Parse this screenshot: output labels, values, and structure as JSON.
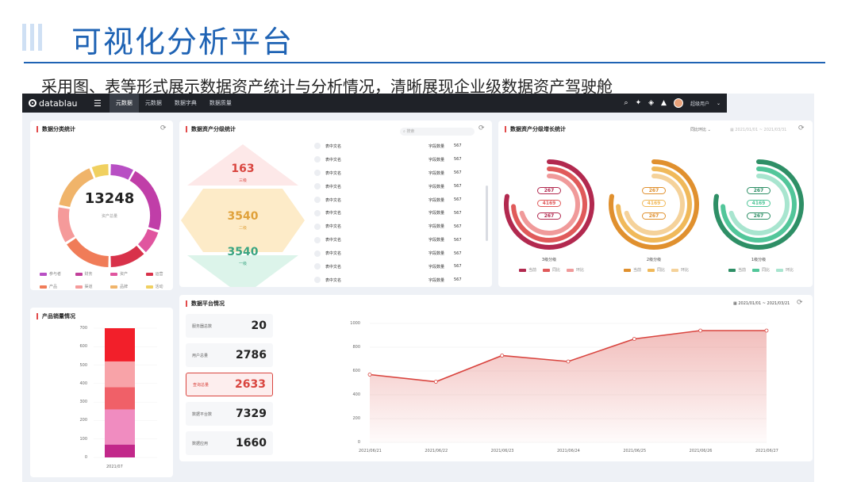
{
  "slide": {
    "title": "可视化分析平台",
    "subtitle": "采用图、表等形式展示数据资产统计与分析情况，清晰展现企业级数据资产驾驶舱"
  },
  "topbar": {
    "logo": "datablau",
    "nav": [
      "元数据",
      "元数据",
      "数据字典",
      "数据质量"
    ],
    "active_index": 0,
    "user": "超级用户"
  },
  "category_stats": {
    "title": "数据分类统计",
    "total": "13248",
    "total_label": "资产总量",
    "legend": [
      {
        "label": "参与者",
        "color": "#b84fc4"
      },
      {
        "label": "财务",
        "color": "#c2409a"
      },
      {
        "label": "资产",
        "color": "#e0559f"
      },
      {
        "label": "运营",
        "color": "#d8324a"
      },
      {
        "label": "产品",
        "color": "#f07c58"
      },
      {
        "label": "渠道",
        "color": "#f59a9a"
      },
      {
        "label": "品牌",
        "color": "#f0b46a"
      },
      {
        "label": "活动",
        "color": "#f0d060"
      }
    ]
  },
  "level_stats": {
    "title": "数据资产分级统计",
    "search_placeholder": "搜索",
    "levels": [
      {
        "value": "163",
        "label": "三级",
        "color": "#d9453f"
      },
      {
        "value": "3540",
        "label": "二级",
        "color": "#e0a13a"
      },
      {
        "value": "3540",
        "label": "一级",
        "color": "#3aa582"
      }
    ],
    "rows": [
      {
        "name": "表中文名",
        "field": "字段数量",
        "count": "567"
      },
      {
        "name": "表中文名",
        "field": "字段数量",
        "count": "567"
      },
      {
        "name": "表中文名",
        "field": "字段数量",
        "count": "567"
      },
      {
        "name": "表中文名",
        "field": "字段数量",
        "count": "567"
      },
      {
        "name": "表中文名",
        "field": "字段数量",
        "count": "567"
      },
      {
        "name": "表中文名",
        "field": "字段数量",
        "count": "567"
      },
      {
        "name": "表中文名",
        "field": "字段数量",
        "count": "567"
      },
      {
        "name": "表中文名",
        "field": "字段数量",
        "count": "567"
      },
      {
        "name": "表中文名",
        "field": "字段数量",
        "count": "567"
      },
      {
        "name": "表中文名",
        "field": "字段数量",
        "count": "567"
      },
      {
        "name": "表中文名",
        "field": "字段数量",
        "count": "567"
      }
    ]
  },
  "growth_stats": {
    "title": "数据资产分级增长统计",
    "compare_select": "同比环比",
    "date_placeholder": "2021/01/01 ~ 2021/03/31",
    "groups": [
      {
        "name": "3级分级",
        "values": [
          "267",
          "4169",
          "267"
        ],
        "colors": [
          "#b2294f",
          "#e05a5a",
          "#f09a9a"
        ],
        "legend": [
          "当前",
          "同比",
          "环比"
        ]
      },
      {
        "name": "2级分级",
        "values": [
          "267",
          "4169",
          "267"
        ],
        "colors": [
          "#e0902e",
          "#f0b95a",
          "#f5d29a"
        ],
        "legend": [
          "当前",
          "同比",
          "环比"
        ]
      },
      {
        "name": "1级分级",
        "values": [
          "267",
          "4169",
          "267"
        ],
        "colors": [
          "#2e8f66",
          "#52c69a",
          "#a8e5cf"
        ],
        "legend": [
          "当前",
          "同比",
          "环比"
        ]
      }
    ]
  },
  "product_sales": {
    "title": "产品销量情况",
    "chart_data": {
      "type": "bar",
      "categories": [
        "2021/07"
      ],
      "yticks": [
        "700",
        "600",
        "500",
        "400",
        "300",
        "200",
        "100",
        "0"
      ],
      "ylim": [
        0,
        700
      ],
      "stacked_segments": [
        {
          "value": 70,
          "color": "#c2288a"
        },
        {
          "value": 190,
          "color": "#f08cc0"
        },
        {
          "value": 120,
          "color": "#f06068"
        },
        {
          "value": 140,
          "color": "#f8a3a8"
        },
        {
          "value": 180,
          "color": "#f21f2a"
        }
      ]
    }
  },
  "platform": {
    "title": "数据平台情况",
    "date_range": "2021/01/01 ~ 2021/03/21",
    "stats": [
      {
        "label": "服务器总数",
        "value": "20",
        "highlight": false
      },
      {
        "label": "用户总量",
        "value": "2786",
        "highlight": false
      },
      {
        "label": "查询总量",
        "value": "2633",
        "highlight": true
      },
      {
        "label": "数据平台数",
        "value": "7329",
        "highlight": false
      },
      {
        "label": "数据应用",
        "value": "1660",
        "highlight": false
      }
    ],
    "chart_data": {
      "type": "area",
      "x": [
        "2021/06/21",
        "2021/06/22",
        "2021/06/23",
        "2021/06/24",
        "2021/06/25",
        "2021/06/26",
        "2021/06/27"
      ],
      "values": [
        570,
        510,
        730,
        680,
        870,
        940,
        940
      ],
      "yticks": [
        "1000",
        "800",
        "600",
        "400",
        "200",
        "0"
      ],
      "ylim": [
        0,
        1000
      ],
      "color": "#d9453f"
    }
  }
}
